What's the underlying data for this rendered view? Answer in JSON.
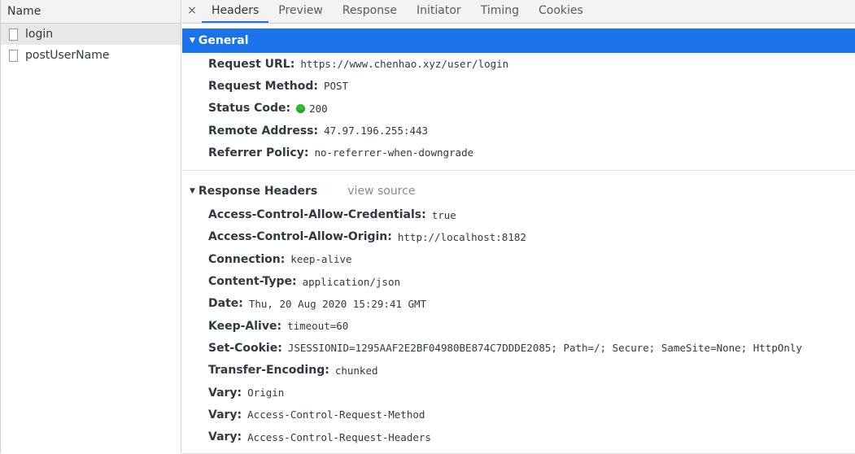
{
  "name_column": {
    "header": "Name",
    "requests": [
      {
        "name": "login",
        "selected": true
      },
      {
        "name": "postUserName",
        "selected": false
      }
    ]
  },
  "tabs": {
    "close": "×",
    "items": [
      "Headers",
      "Preview",
      "Response",
      "Initiator",
      "Timing",
      "Cookies"
    ],
    "active": "Headers"
  },
  "general": {
    "title": "General",
    "request_url_label": "Request URL:",
    "request_url": "https://www.chenhao.xyz/user/login",
    "request_method_label": "Request Method:",
    "request_method": "POST",
    "status_code_label": "Status Code:",
    "status_code": "200",
    "status_color": "#2fbf32",
    "remote_address_label": "Remote Address:",
    "remote_address": "47.97.196.255:443",
    "referrer_policy_label": "Referrer Policy:",
    "referrer_policy": "no-referrer-when-downgrade"
  },
  "response_headers": {
    "title": "Response Headers",
    "view_source": "view source",
    "rows": [
      {
        "name": "Access-Control-Allow-Credentials:",
        "value": "true"
      },
      {
        "name": "Access-Control-Allow-Origin:",
        "value": "http://localhost:8182"
      },
      {
        "name": "Connection:",
        "value": "keep-alive"
      },
      {
        "name": "Content-Type:",
        "value": "application/json"
      },
      {
        "name": "Date:",
        "value": "Thu, 20 Aug 2020 15:29:41 GMT"
      },
      {
        "name": "Keep-Alive:",
        "value": "timeout=60"
      },
      {
        "name": "Set-Cookie:",
        "value": "JSESSIONID=1295AAF2E2BF04980BE874C7DDDE2085; Path=/; Secure; SameSite=None; HttpOnly"
      },
      {
        "name": "Transfer-Encoding:",
        "value": "chunked"
      },
      {
        "name": "Vary:",
        "value": "Origin"
      },
      {
        "name": "Vary:",
        "value": "Access-Control-Request-Method"
      },
      {
        "name": "Vary:",
        "value": "Access-Control-Request-Headers"
      }
    ]
  },
  "colors": {
    "accent": "#1a73e8",
    "selected_row": "#e8e8e8",
    "toolbar_bg": "#f3f3f3"
  }
}
